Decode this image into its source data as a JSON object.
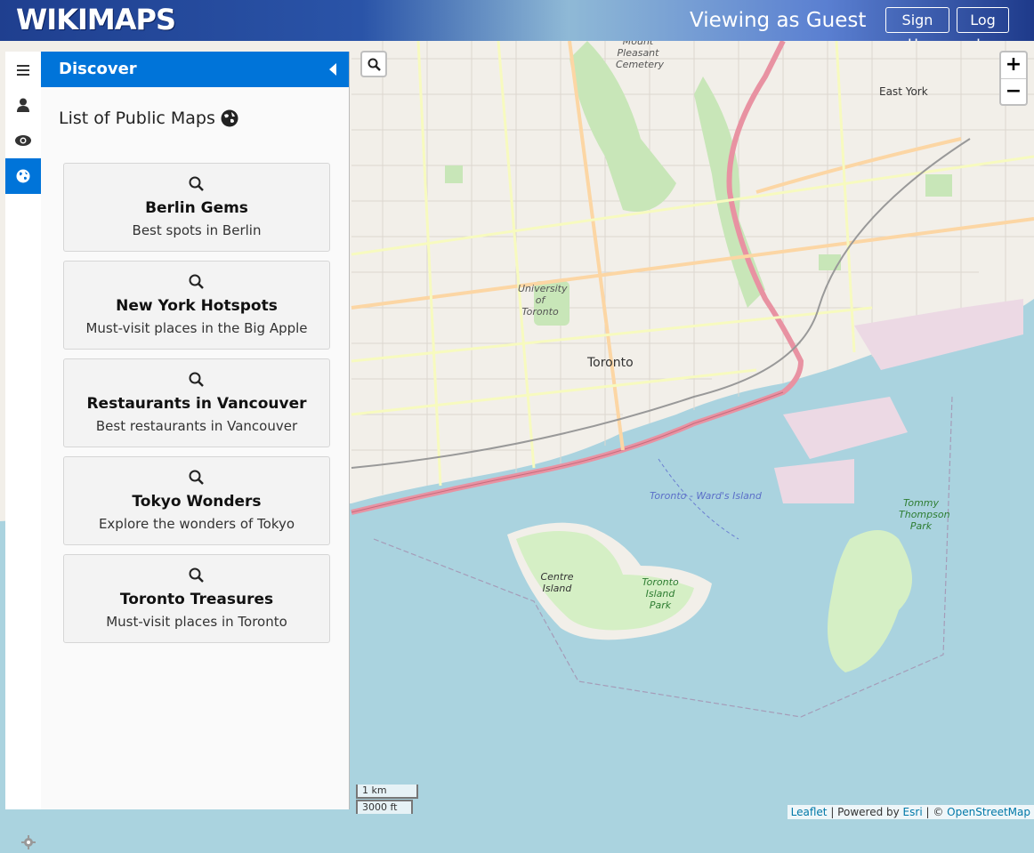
{
  "header": {
    "logo": "WIKIMAPS",
    "viewing": "Viewing as Guest",
    "signup": "Sign Up",
    "login": "Log In"
  },
  "sidebar": {
    "tabs": [
      "menu-icon",
      "user-icon",
      "eye-icon",
      "globe-icon"
    ],
    "active_tab": "globe-icon",
    "pane_title": "Discover",
    "list_title": "List of Public Maps",
    "maps": [
      {
        "name": "Berlin Gems",
        "desc": "Best spots in Berlin"
      },
      {
        "name": "New York Hotspots",
        "desc": "Must-visit places in the Big Apple"
      },
      {
        "name": "Restaurants in Vancouver",
        "desc": "Best restaurants in Vancouver"
      },
      {
        "name": "Tokyo Wonders",
        "desc": "Explore the wonders of Tokyo"
      },
      {
        "name": "Toronto Treasures",
        "desc": "Must-visit places in Toronto"
      }
    ]
  },
  "map": {
    "zoom_in": "+",
    "zoom_out": "−",
    "scale_metric": "1 km",
    "scale_imperial": "3000 ft",
    "labels": {
      "toronto": "Toronto",
      "east_york": "East York",
      "university": "University of Toronto",
      "centre_island": "Centre Island",
      "island_park": "Toronto Island Park",
      "tommy": "Tommy Thompson Park",
      "cemetery": "Mount Pleasant Cemetery",
      "ferry": "Toronto - Ward's Island"
    },
    "attribution": {
      "leaflet": "Leaflet",
      "powered": " | Powered by ",
      "esri": "Esri",
      "sep": " | © ",
      "osm": "OpenStreetMap"
    }
  },
  "colors": {
    "header_start": "#1f3f8f",
    "accent": "#0074d9",
    "water": "#aad3df",
    "land": "#f2efe9"
  }
}
